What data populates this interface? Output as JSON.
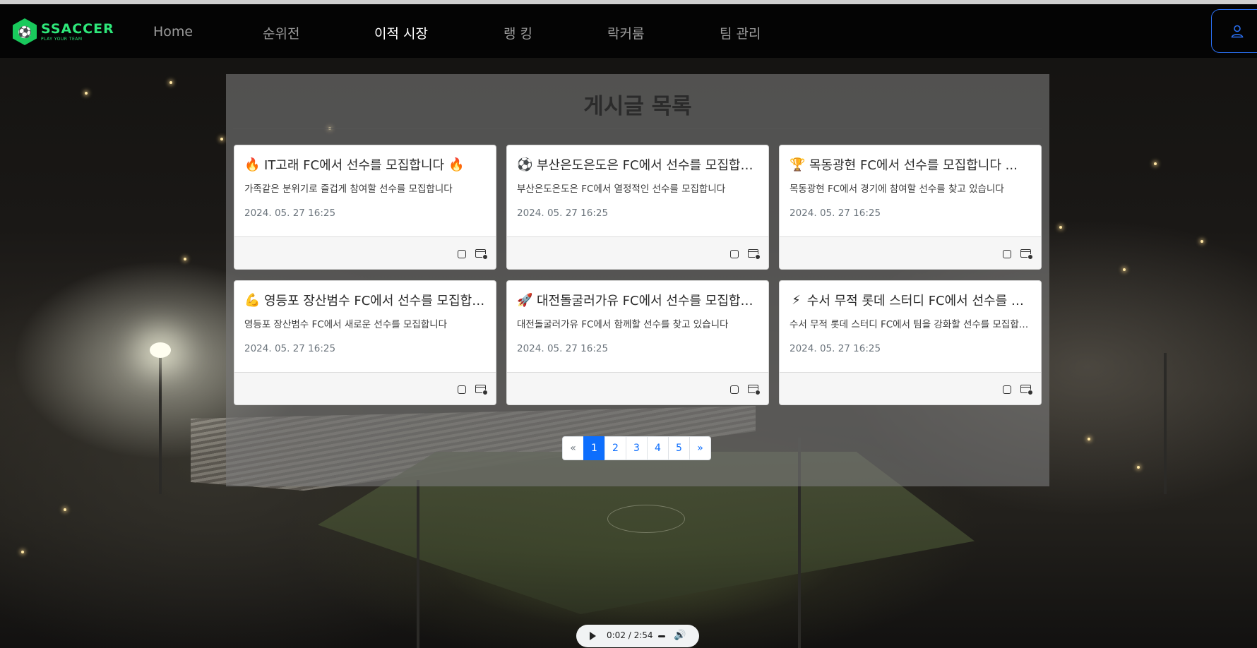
{
  "brand": {
    "name": "SSACCER",
    "tagline": "PLAY YOUR TEAM",
    "colors": {
      "accent": "#2ee87a",
      "primary": "#0d6efd"
    }
  },
  "nav": {
    "items": [
      {
        "label": "Home"
      },
      {
        "label": "순위전"
      },
      {
        "label": "이적 시장",
        "active": true
      },
      {
        "label": "랭 킹"
      },
      {
        "label": "락커룸"
      },
      {
        "label": "팀 관리"
      }
    ],
    "user_icon": "user-icon"
  },
  "board": {
    "title": "게시글 목록",
    "posts": [
      {
        "emoji": "🔥",
        "emoji_end": "🔥",
        "title": "IT고래 FC에서 선수를 모집합니다",
        "text": "가족같은 분위기로 즐겁게 참여할 선수를 모집합니다",
        "date": "2024. 05. 27 16:25"
      },
      {
        "emoji": "⚽",
        "emoji_end": "",
        "title": "부산은도은도은 FC에서 선수를 모집합니다",
        "text": "부산은도은도은 FC에서 열정적인 선수를 모집합니다",
        "date": "2024. 05. 27 16:25"
      },
      {
        "emoji": "🏆",
        "emoji_end": "",
        "title": "목동광현 FC에서 선수를 모집합니다 ...",
        "text": "목동광현 FC에서 경기에 참여할 선수를 찾고 있습니다",
        "date": "2024. 05. 27 16:25"
      },
      {
        "emoji": "💪",
        "emoji_end": "",
        "title": "영등포 장산범수 FC에서 선수를 모집합니다",
        "text": "영등포 장산범수 FC에서 새로운 선수를 모집합니다",
        "date": "2024. 05. 27 16:25"
      },
      {
        "emoji": "🚀",
        "emoji_end": "",
        "title": "대전돌굴러가유 FC에서 선수를 모집합니다",
        "text": "대전돌굴러가유 FC에서 함께할 선수를 찾고 있습니다",
        "date": "2024. 05. 27 16:25"
      },
      {
        "emoji": "⚡",
        "emoji_end": "",
        "title": "수서 무적 롯데 스터디 FC에서 선수를 모집합니다",
        "text": "수서 무적 롯데 스터디 FC에서 팀을 강화할 선수를 모집합니다",
        "date": "2024. 05. 27 16:25"
      }
    ]
  },
  "pagination": {
    "prev": "«",
    "next": "»",
    "pages": [
      "1",
      "2",
      "3",
      "4",
      "5"
    ],
    "current": "1"
  },
  "audio": {
    "time": "0:02 / 2:54"
  }
}
